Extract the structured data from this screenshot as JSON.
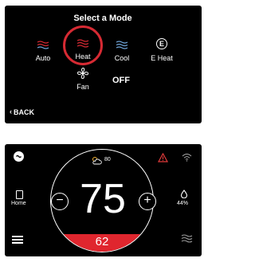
{
  "mode_screen": {
    "title": "Select a Mode",
    "modes": [
      {
        "label": "Auto",
        "icon": "auto-wave-icon",
        "selected": false
      },
      {
        "label": "Heat",
        "icon": "heat-wave-icon",
        "selected": true
      },
      {
        "label": "Cool",
        "icon": "cool-wave-icon",
        "selected": false
      },
      {
        "label": "E Heat",
        "icon": "emergency-heat-icon",
        "icon_text": "E",
        "selected": false
      }
    ],
    "fan": {
      "label": "Fan",
      "icon": "fan-icon"
    },
    "off_label": "OFF",
    "back_label": "BACK",
    "colors": {
      "heat": "#d62a33",
      "cool": "#6fa4d8",
      "selection_ring": "#d62a33"
    }
  },
  "thermostat_screen": {
    "logo_icon": "rheem-logo-icon",
    "weather": {
      "icon": "partly-sunny-icon",
      "outdoor_temp": "80"
    },
    "alert_icon": "warning-triangle-icon",
    "wifi_icon": "wifi-icon",
    "home": {
      "label": "Home",
      "icon": "home-device-icon"
    },
    "humidity": {
      "value": "44%",
      "icon": "water-drop-icon"
    },
    "current_temp": "75",
    "setpoint": "62",
    "minus_label": "−",
    "plus_label": "+",
    "menu_icon": "hamburger-menu-icon",
    "mode_icon": "heat-wave-icon",
    "colors": {
      "setpoint_bar": "#e0262e",
      "alert": "#e23b3b"
    }
  }
}
